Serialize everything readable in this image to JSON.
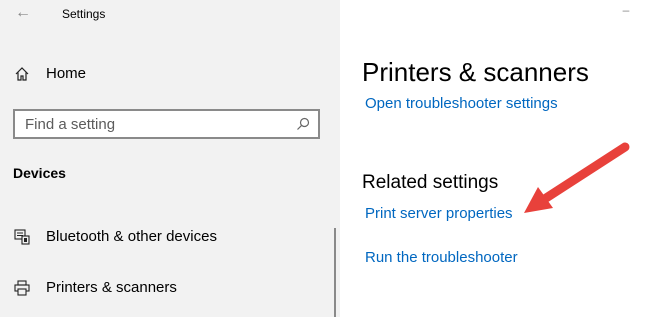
{
  "window": {
    "title": "Settings",
    "back_icon": "back-arrow-icon",
    "minimize_icon": "minimize-icon"
  },
  "sidebar": {
    "home_label": "Home",
    "search": {
      "placeholder": "Find a setting",
      "icon": "search-icon"
    },
    "section_heading": "Devices",
    "items": [
      {
        "label": "Bluetooth & other devices",
        "icon": "bluetooth-devices-icon"
      },
      {
        "label": "Printers & scanners",
        "icon": "printer-icon"
      }
    ]
  },
  "main": {
    "title": "Printers & scanners",
    "links": {
      "troubleshooter_settings": "Open troubleshooter settings",
      "print_server_properties": "Print server properties",
      "run_troubleshooter": "Run the troubleshooter"
    },
    "related_heading": "Related settings",
    "annotation": {
      "icon": "annotation-arrow",
      "color": "#e8413b"
    }
  },
  "colors": {
    "link": "#0067c0",
    "sidebar_bg": "#f2f2f2",
    "main_bg": "#ffffff"
  }
}
